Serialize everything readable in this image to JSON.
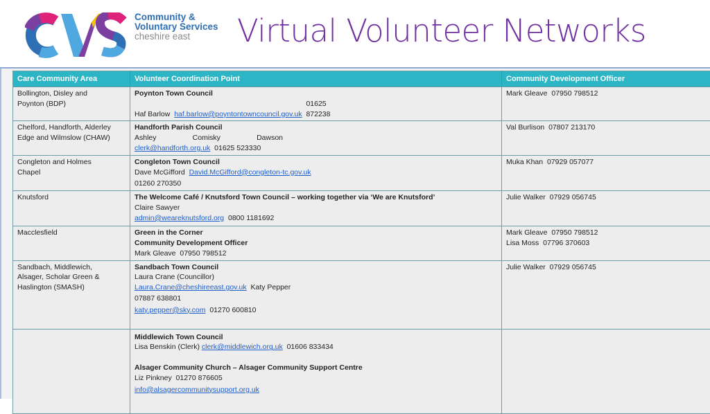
{
  "header": {
    "logo": {
      "acronym": "CVS",
      "line1": "Community &",
      "line2": "Voluntary Services",
      "line3": "cheshire east",
      "colors": {
        "blue": "#2f6fb5",
        "light_blue": "#4fa8e0",
        "purple": "#7b3fa0",
        "magenta": "#e0237a",
        "yellow": "#f6c400",
        "grey": "#8a8a8a"
      }
    },
    "title": "Virtual Volunteer Networks"
  },
  "colors": {
    "title": "#7030a0",
    "table_header_bg": "#2cb5c5",
    "table_border": "#6b9ea4",
    "link": "#1f5fcc"
  },
  "table": {
    "columns": [
      "Care Community Area",
      "Volunteer Coordination Point",
      "Community Development Officer"
    ],
    "rows": [
      {
        "area": "Bollington, Disley and Poynton (BDP)",
        "org": "Poynton Town Council",
        "contact": "Haf Barlow",
        "email": "haf.barlow@poyntontowncouncil.gov.uk",
        "phone": "01625 872238",
        "officer": [
          "Mark Gleave  07950 798512"
        ]
      },
      {
        "area": "Chelford, Handforth,  Alderley Edge and Wilmslow (CHAW)",
        "org": "Handforth Parish Council",
        "contact_parts": [
          "Ashley",
          "Comisky",
          "Dawson"
        ],
        "email": "clerk@handforth.org.uk",
        "phone": "01625 523330",
        "officer": [
          "Val Burlison  07807 213170"
        ]
      },
      {
        "area": "Congleton and Holmes Chapel",
        "org": "Congleton Town Council",
        "contact": "Dave McGifford",
        "email": "David.McGifford@congleton-tc.gov.uk",
        "phone": "01260 270350",
        "officer": [
          "Muka Khan  07929 057077"
        ]
      },
      {
        "area": "Knutsford",
        "org": "The Welcome Café / Knutsford Town Council – working together via ‘We are Knutsford’",
        "contact": "Claire Sawyer",
        "email": "admin@weareknutsford.org",
        "phone": "0800 1181692",
        "officer": [
          "Julie Walker  07929 056745"
        ]
      },
      {
        "area": "Macclesfield",
        "org": "Green in the Corner",
        "org2": "Community Development Officer",
        "contact": "Mark Gleave  07950 798512",
        "officer": [
          "Mark Gleave  07950 798512",
          "Lisa Moss  07796 370603"
        ]
      },
      {
        "area": "Sandbach, Middlewich, Alsager, Scholar Green & Haslington (SMASH)",
        "org": "Sandbach Town Council",
        "contact": "Laura Crane (Councillor)",
        "email": "Laura.Crane@cheshireeast.gov.uk",
        "contact2": "Katy Pepper",
        "phone2": "07887 638801",
        "email2": "katy.pepper@sky.com",
        "phone3": "01270 600810",
        "officer": [
          "Julie Walker  07929 056745"
        ]
      },
      {
        "area": "",
        "org": "Middlewich Town Council",
        "contact": "Lisa Benskin (Clerk)",
        "email": "clerk@middlewich.org.uk",
        "phone": "01606 833434",
        "org2": "Alsager Community Church – Alsager Community Support Centre",
        "contact2": "Liz Pinkney  01270 876605",
        "email2": "info@alsagercommunitysupport.org.uk",
        "officer": []
      }
    ]
  }
}
